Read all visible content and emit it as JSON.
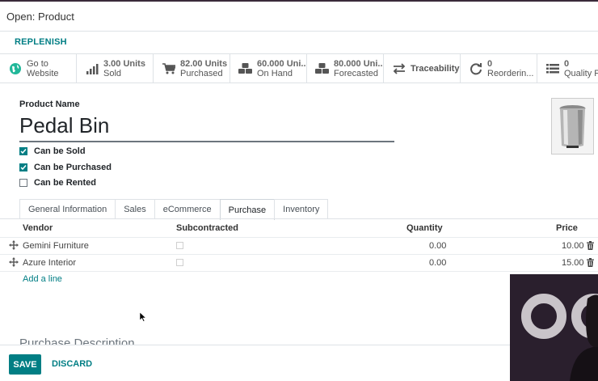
{
  "dialog": {
    "title": "Open: Product"
  },
  "actions": {
    "replenish": "REPLENISH"
  },
  "smart_buttons": [
    {
      "icon": "globe-icon",
      "line1": "Go to",
      "line2": "Website"
    },
    {
      "icon": "bar-chart-icon",
      "line1": "3.00 Units",
      "line2": "Sold"
    },
    {
      "icon": "cart-icon",
      "line1": "82.00 Units",
      "line2": "Purchased"
    },
    {
      "icon": "cubes-icon",
      "line1": "60.000 Uni...",
      "line2": "On Hand"
    },
    {
      "icon": "cubes-icon",
      "line1": "80.000 Uni...",
      "line2": "Forecasted"
    },
    {
      "icon": "exchange-icon",
      "line1": "Traceability"
    },
    {
      "icon": "refresh-icon",
      "line1": "0",
      "line2": "Reorderin..."
    },
    {
      "icon": "list-icon",
      "line1": "0",
      "line2": "Quality Po"
    }
  ],
  "form": {
    "product_name_label": "Product Name",
    "product_name": "Pedal Bin",
    "image_subject": "stainless steel pedal bin",
    "checkboxes": [
      {
        "label": "Can be Sold",
        "checked": true
      },
      {
        "label": "Can be Purchased",
        "checked": true
      },
      {
        "label": "Can be Rented",
        "checked": false
      }
    ]
  },
  "tabs": [
    {
      "label": "General Information",
      "active": false
    },
    {
      "label": "Sales",
      "active": false
    },
    {
      "label": "eCommerce",
      "active": false
    },
    {
      "label": "Purchase",
      "active": true
    },
    {
      "label": "Inventory",
      "active": false
    }
  ],
  "vendor_table": {
    "headers": {
      "vendor": "Vendor",
      "subcontracted": "Subcontracted",
      "quantity": "Quantity",
      "price": "Price"
    },
    "rows": [
      {
        "vendor": "Gemini Furniture",
        "subcontracted": false,
        "quantity": "0.00",
        "price": "10.00"
      },
      {
        "vendor": "Azure Interior",
        "subcontracted": false,
        "quantity": "0.00",
        "price": "15.00"
      }
    ],
    "add_line": "Add a line"
  },
  "purchase_description_heading": "Purchase Description",
  "footer": {
    "save": "SAVE",
    "discard": "DISCARD"
  },
  "colors": {
    "accent": "#017e84",
    "text": "#212529",
    "border": "#dee2e6"
  }
}
